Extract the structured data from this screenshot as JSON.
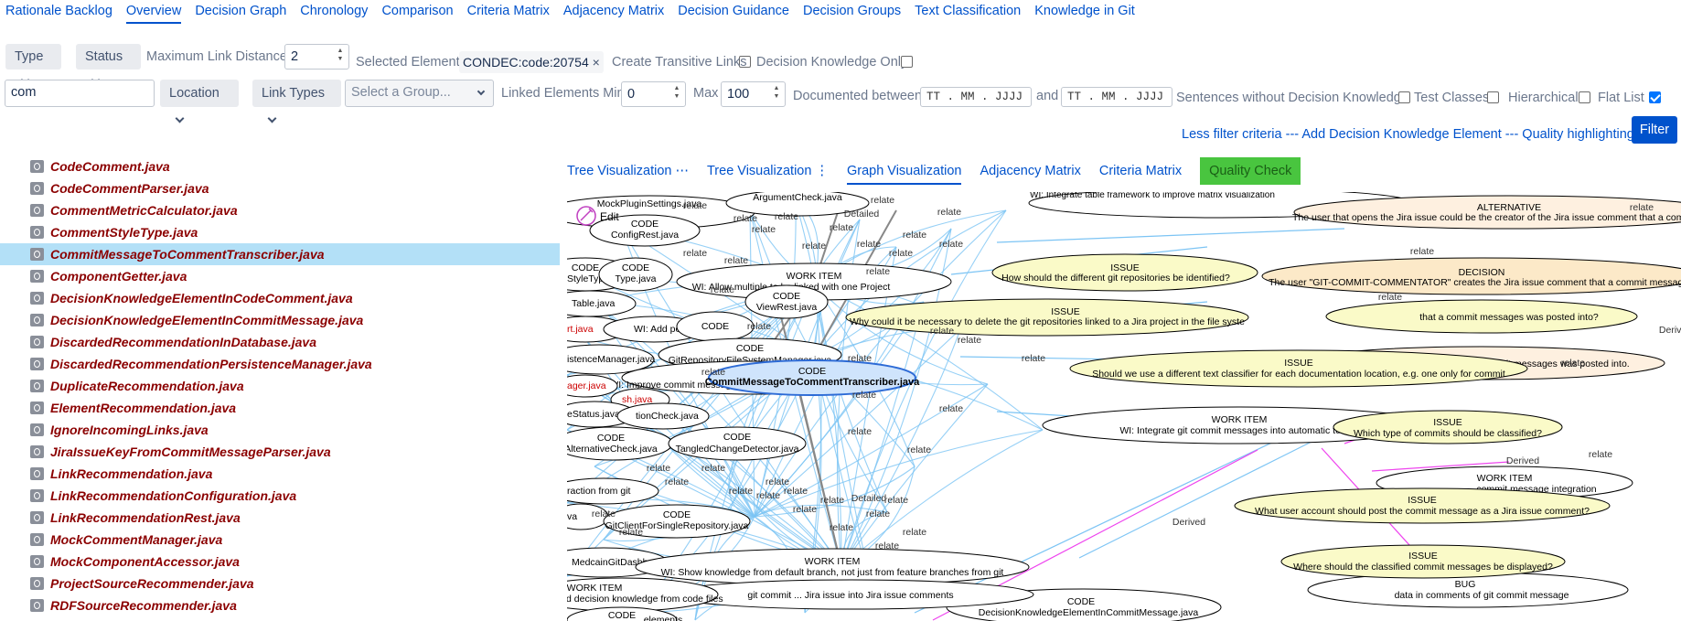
{
  "nav_tabs": [
    {
      "label": "Rationale Backlog"
    },
    {
      "label": "Overview",
      "active": true
    },
    {
      "label": "Decision Graph"
    },
    {
      "label": "Chronology"
    },
    {
      "label": "Comparison"
    },
    {
      "label": "Criteria Matrix"
    },
    {
      "label": "Adjacency Matrix"
    },
    {
      "label": "Decision Guidance"
    },
    {
      "label": "Decision Groups"
    },
    {
      "label": "Text Classification"
    },
    {
      "label": "Knowledge in Git"
    }
  ],
  "filters": {
    "type_label": "Type",
    "status_label": "Status",
    "max_link_distance_label": "Maximum Link Distance",
    "max_link_distance_value": "2",
    "selected_element_label": "Selected Element:",
    "selected_element_value": "CONDEC:code:20754",
    "create_transitive_links_label": "Create Transitive Links",
    "decision_knowledge_only_label": "Decision Knowledge Only",
    "search_value": "com",
    "location_label": "Location",
    "link_types_label": "Link Types",
    "group_placeholder": "Select a Group...",
    "linked_elements_min_label": "Linked Elements Min",
    "linked_elements_min_value": "0",
    "max_label": "Max",
    "max_value": "100",
    "documented_between_label": "Documented between",
    "date_placeholder": "TT . MM . JJJJ",
    "and_label": "and",
    "sentences_label": "Sentences without Decision Knowledge",
    "test_classes_label": "Test Classes",
    "hierarchical_label": "Hierarchical",
    "flat_list_label": "Flat List",
    "flat_list_checked": true,
    "less_filter_link": "Less filter criteria --- Add Decision Knowledge Element --- Quality highlighting",
    "filter_button": "Filter"
  },
  "tree_items": [
    {
      "label": "CodeComment.java"
    },
    {
      "label": "CodeCommentParser.java"
    },
    {
      "label": "CommentMetricCalculator.java"
    },
    {
      "label": "CommentStyleType.java"
    },
    {
      "label": "CommitMessageToCommentTranscriber.java",
      "selected": true
    },
    {
      "label": "ComponentGetter.java"
    },
    {
      "label": "DecisionKnowledgeElementInCodeComment.java"
    },
    {
      "label": "DecisionKnowledgeElementInCommitMessage.java"
    },
    {
      "label": "DiscardedRecommendationInDatabase.java"
    },
    {
      "label": "DiscardedRecommendationPersistenceManager.java"
    },
    {
      "label": "DuplicateRecommendation.java"
    },
    {
      "label": "ElementRecommendation.java"
    },
    {
      "label": "IgnoreIncomingLinks.java"
    },
    {
      "label": "JiraIssueKeyFromCommitMessageParser.java"
    },
    {
      "label": "LinkRecommendation.java"
    },
    {
      "label": "LinkRecommendationConfiguration.java"
    },
    {
      "label": "LinkRecommendationRest.java"
    },
    {
      "label": "MockCommentManager.java"
    },
    {
      "label": "MockComponentAccessor.java"
    },
    {
      "label": "ProjectSourceRecommender.java"
    },
    {
      "label": "RDFSourceRecommender.java"
    }
  ],
  "view_tabs": [
    {
      "label": "Tree Visualization ⋯"
    },
    {
      "label": "Tree Visualization ⋮"
    },
    {
      "label": "Graph Visualization",
      "active": true
    },
    {
      "label": "Adjacency Matrix"
    },
    {
      "label": "Criteria Matrix"
    },
    {
      "label": "Quality Check",
      "qc": true
    }
  ],
  "graph": {
    "edit_label": "Edit",
    "node_labels": [
      {
        "type": "CODE",
        "text": "ConfigRest.java"
      },
      {
        "type": "",
        "text": "ArgumentCheck.java"
      },
      {
        "type": "WORK ITEM",
        "text": "WI: Allow multiple  to be linked with one Project"
      },
      {
        "type": "CODE",
        "text": "ViewRest.java"
      },
      {
        "type": "CODE",
        "text": "GitRepositoryFileSystemManager.java"
      },
      {
        "type": "CODE",
        "text": "CommitMessageToCommentTranscriber.java"
      },
      {
        "type": "",
        "text": "WI: Improve commit message transcription into Jira issue comments"
      },
      {
        "type": "CODE",
        "text": "TangledChangeDetector.java"
      },
      {
        "type": "CODE",
        "text": "AlternativeCheck.java"
      },
      {
        "type": "CODE",
        "text": "GitClientForSingleRepository.java"
      },
      {
        "type": "WORK ITEM",
        "text": "WI: Show knowledge from default branch, not just from feature branches from git"
      },
      {
        "type": "",
        "text": "git commit ... Jira issue into Jira issue comments"
      },
      {
        "type": "WORK ITEM",
        "text": "from git and decision knowledge from code files"
      },
      {
        "type": "CODE",
        "text": "DecisionKnowledgeElementInCommitMessage.java"
      },
      {
        "type": "ALTERNATIVE",
        "text": "The user that opens the Jira issue could be the creator of the Jira issue comment that a commit mes..."
      },
      {
        "type": "ISSUE",
        "text": "How should the different git repositories be identified?"
      },
      {
        "type": "DECISION",
        "text": "The user \"GIT-COMMIT-COMMENTATOR\" creates the Jira issue comment that a commit messages was pos"
      },
      {
        "type": "ISSUE",
        "text": "Why could it be necessary to delete the git repositories linked to a Jira project in the file syste"
      },
      {
        "type": "",
        "text": "that a commit messages was posted into?"
      },
      {
        "type": "ISSUE",
        "text": "Should we use a different text classifier for each documentation location, e.g. one only for commit"
      },
      {
        "type": "",
        "text": "commit messages was posted into."
      },
      {
        "type": "WORK ITEM",
        "text": "WI: Integrate git commit messages into automatic text clas"
      },
      {
        "type": "ISSUE",
        "text": "Which type of commits should be classified?"
      },
      {
        "type": "WORK ITEM",
        "text": "commit message integration"
      },
      {
        "type": "ISSUE",
        "text": "What user account should post the commit message as a Jira issue comment?"
      },
      {
        "type": "ISSUE",
        "text": "Where should the classified commit messages be displayed?"
      },
      {
        "type": "BUG",
        "text": "data in comments of git commit message"
      },
      {
        "type": "",
        "text": "WI: Integrate table framework to improve matrix visualization"
      },
      {
        "type": "",
        "text": "MockPluginSettings.java"
      },
      {
        "type": "CODE",
        "text": "StyleType.java"
      },
      {
        "type": "CODE",
        "text": "Type.java"
      },
      {
        "type": "",
        "text": "Table.java"
      },
      {
        "type": "",
        "text": "rt.java"
      },
      {
        "type": "",
        "text": "WI: Add po"
      },
      {
        "type": "CODE",
        "text": ""
      },
      {
        "type": "",
        "text": "istenceManager.java"
      },
      {
        "type": "",
        "text": "ager.java"
      },
      {
        "type": "",
        "text": "sh.java"
      },
      {
        "type": "",
        "text": "eStatus.java"
      },
      {
        "type": "",
        "text": "tionCheck.java"
      },
      {
        "type": "",
        "text": "raction from git"
      },
      {
        "type": "",
        "text": "va"
      },
      {
        "type": "",
        "text": "MedcainGitDashboa"
      },
      {
        "type": "CODE",
        "text": ""
      },
      {
        "type": "",
        "text": "elements"
      }
    ],
    "edge_labels": {
      "relate": "relate",
      "derived": "Derived",
      "detailed": "Detailed"
    }
  }
}
